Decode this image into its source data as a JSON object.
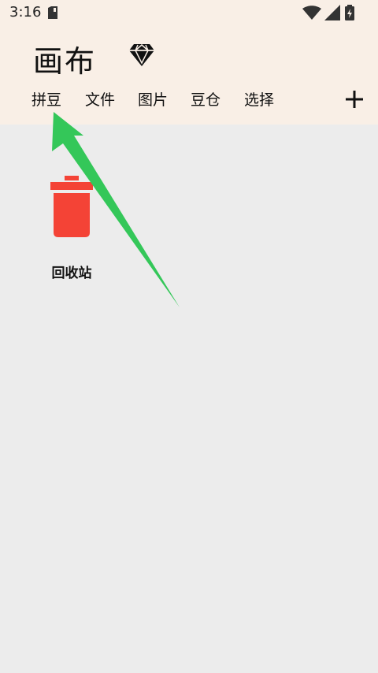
{
  "status_bar": {
    "time": "3:16",
    "icons": [
      "sd-card-icon",
      "wifi-icon",
      "cellular-signal-icon",
      "battery-icon"
    ]
  },
  "header": {
    "title": "画布",
    "premium_icon": "diamond-icon"
  },
  "tabs": [
    {
      "label": "拼豆"
    },
    {
      "label": "文件"
    },
    {
      "label": "图片"
    },
    {
      "label": "豆仓"
    },
    {
      "label": "选择"
    }
  ],
  "actions": {
    "add_icon": "plus-icon"
  },
  "content": {
    "items": [
      {
        "label": "回收站",
        "icon": "trash-icon"
      }
    ]
  },
  "colors": {
    "header_bg": "#f9efe6",
    "content_bg": "#ececec",
    "trash_red": "#f44336",
    "annotation_arrow": "#34c759"
  }
}
